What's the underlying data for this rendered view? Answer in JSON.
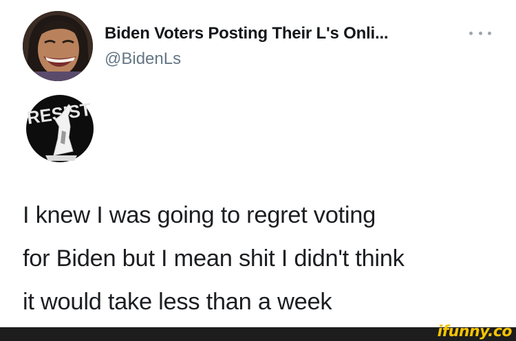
{
  "tweet": {
    "author_name": "Biden Voters Posting Their L's Onli...",
    "author_handle": "@BidenLs",
    "more_icon": "more-horizontal-icon",
    "text_lines": [
      "I knew I was going to regret voting",
      "for Biden but I mean shit I didn't think",
      "it would take less than a week"
    ],
    "media_text": "RESIST"
  },
  "footer": {
    "watermark": "ifunny.co"
  },
  "colors": {
    "name": "#14171a",
    "handle": "#657786",
    "text": "#1c1e21",
    "footer_bg": "#1d1d1d",
    "watermark": "#f5c400"
  }
}
